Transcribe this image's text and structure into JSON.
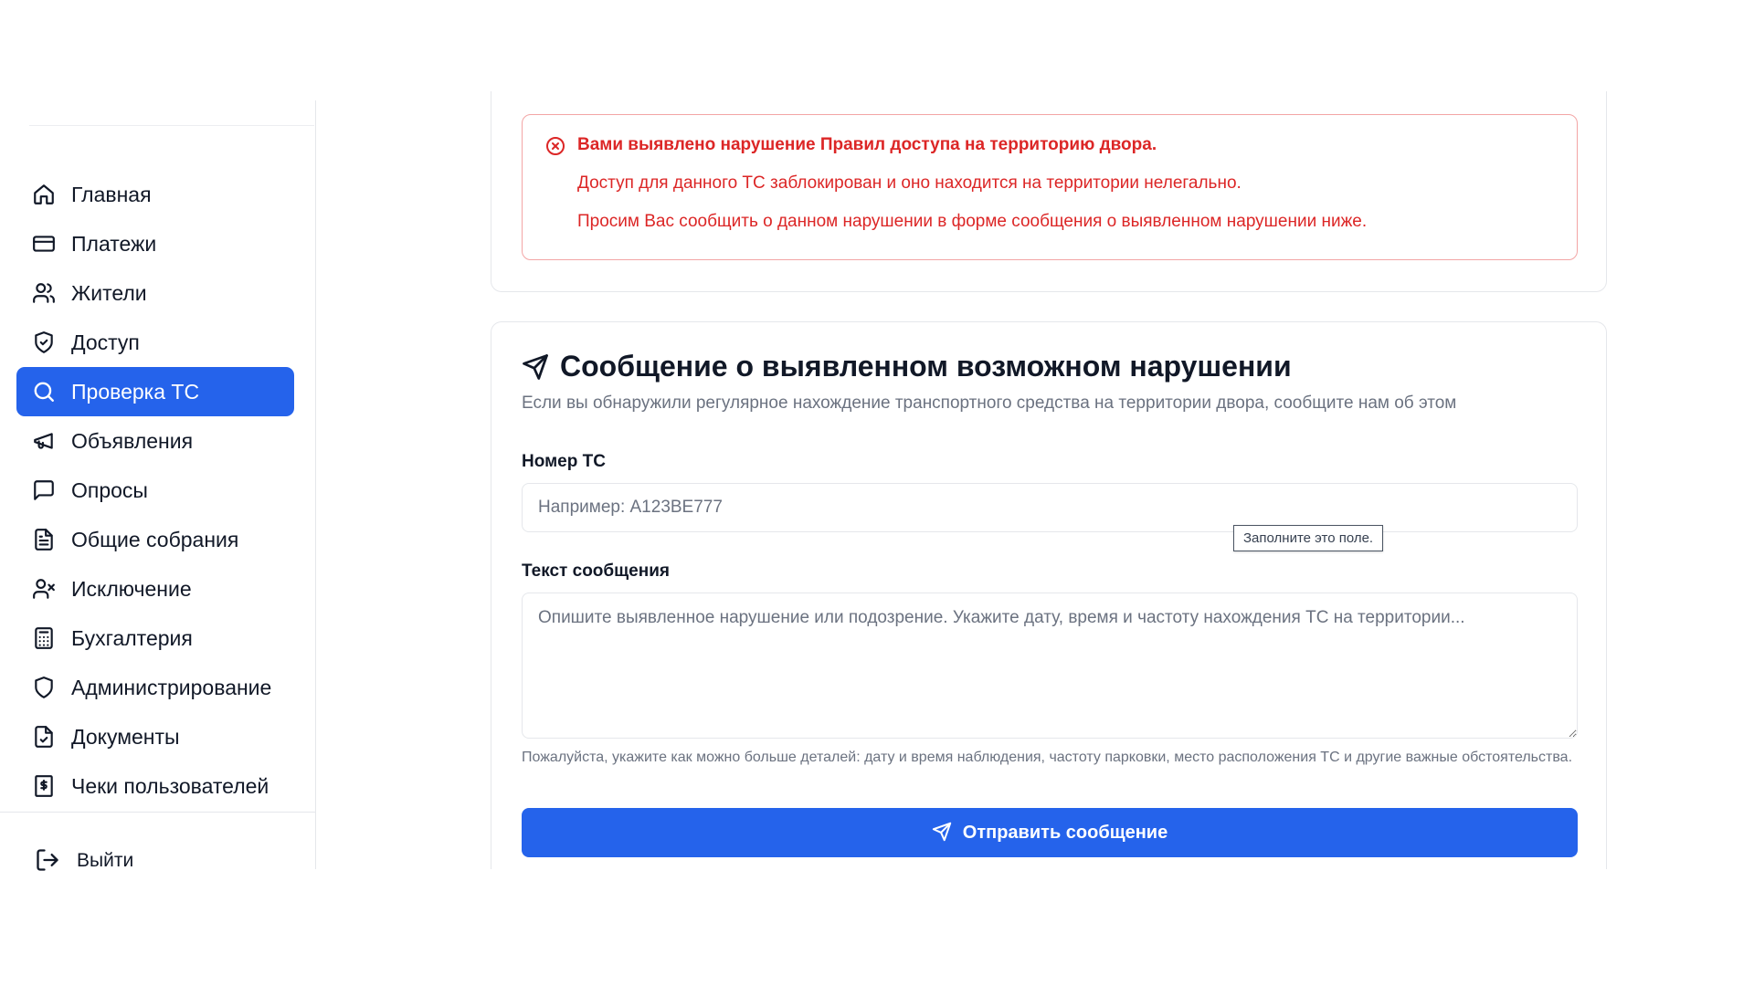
{
  "colors": {
    "accent": "#2563eb",
    "error": "#dc2626",
    "error_border": "#f3a5a5",
    "muted_text": "#6b7280"
  },
  "sidebar": {
    "items": [
      {
        "label": "Главная",
        "icon": "home-icon"
      },
      {
        "label": "Платежи",
        "icon": "credit-card-icon"
      },
      {
        "label": "Жители",
        "icon": "users-icon"
      },
      {
        "label": "Доступ",
        "icon": "shield-check-icon"
      },
      {
        "label": "Проверка ТС",
        "icon": "search-icon",
        "active": true
      },
      {
        "label": "Объявления",
        "icon": "megaphone-icon"
      },
      {
        "label": "Опросы",
        "icon": "message-square-icon"
      },
      {
        "label": "Общие собрания",
        "icon": "file-text-icon"
      },
      {
        "label": "Исключение",
        "icon": "user-x-icon"
      },
      {
        "label": "Бухгалтерия",
        "icon": "calculator-icon"
      },
      {
        "label": "Администрирование",
        "icon": "shield-icon"
      },
      {
        "label": "Документы",
        "icon": "file-check-icon"
      },
      {
        "label": "Чеки пользователей",
        "icon": "receipt-icon"
      }
    ],
    "logout_label": "Выйти"
  },
  "alert": {
    "lines": [
      "Вами выявлено нарушение Правил доступа на территорию двора.",
      "Доступ для данного ТС заблокирован и оно находится на территории нелегально.",
      "Просим Вас сообщить о данном нарушении в форме сообщения о выявленном нарушении ниже."
    ]
  },
  "form": {
    "title": "Сообщение о выявленном возможном нарушении",
    "subtitle": "Если вы обнаружили регулярное нахождение транспортного средства на территории двора, сообщите нам об этом",
    "plate_label": "Номер ТС",
    "plate_placeholder": "Например: А123ВЕ777",
    "plate_value": "",
    "validation_tooltip": "Заполните это поле.",
    "message_label": "Текст сообщения",
    "message_placeholder": "Опишите выявленное нарушение или подозрение. Укажите дату, время и частоту нахождения ТС на территории...",
    "message_value": "",
    "hint": "Пожалуйста, укажите как можно больше деталей: дату и время наблюдения, частоту парковки, место расположения ТС и другие важные обстоятельства.",
    "submit_label": "Отправить сообщение"
  }
}
